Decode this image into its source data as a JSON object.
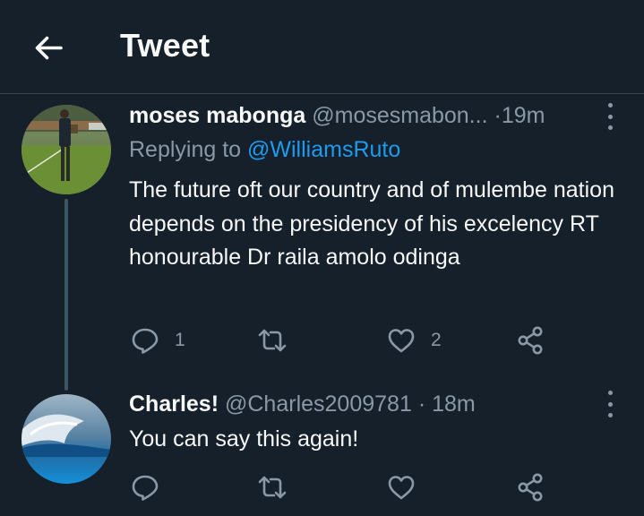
{
  "header": {
    "title": "Tweet"
  },
  "tweets": [
    {
      "name": "moses mabonga",
      "handle": "@mosesmabon...",
      "separator": "·",
      "time": "19m",
      "replying_prefix": "Replying to",
      "replying_handle": "@WilliamsRuto",
      "text": "The future oft our country and of mulembe nation depends on the presidency of his excelency RT honourable Dr raila amolo odinga",
      "reply_count": "1",
      "retweet_count": "",
      "like_count": "2"
    },
    {
      "name": "Charles!",
      "handle": "@Charles2009781",
      "separator": "·",
      "time": "18m",
      "text": "You can say this again!",
      "reply_count": "",
      "retweet_count": "",
      "like_count": ""
    }
  ],
  "icons": {
    "back": "arrow-left-icon",
    "more": "more-vertical-icon",
    "reply": "reply-icon",
    "retweet": "retweet-icon",
    "like": "heart-icon",
    "share": "share-icon"
  },
  "colors": {
    "background": "#15202b",
    "text_primary": "#f7f9f9",
    "text_secondary": "#8b98a5",
    "accent": "#1d9bf0",
    "divider": "#38444d",
    "thread_line": "#3d5466"
  }
}
